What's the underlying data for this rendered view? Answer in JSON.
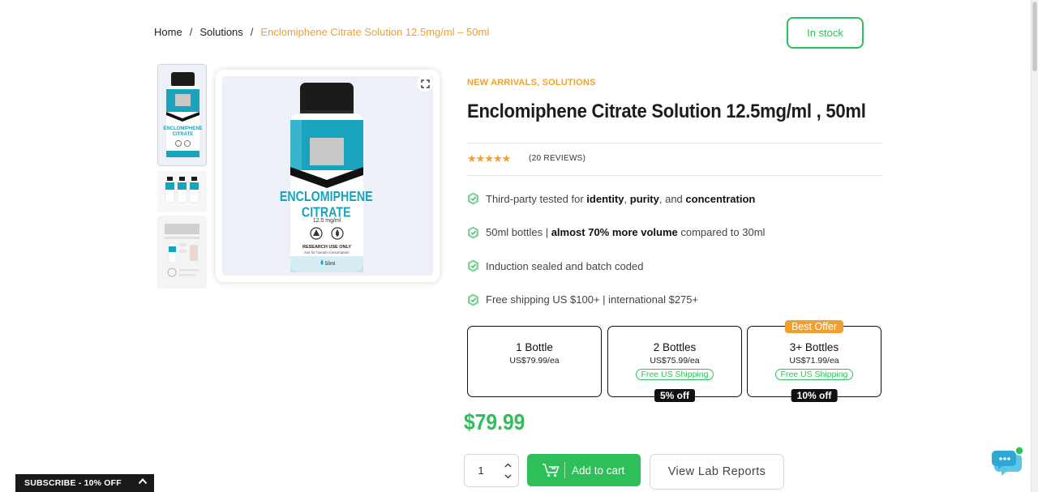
{
  "breadcrumb": {
    "home": "Home",
    "separator": "/",
    "section": "Solutions",
    "current": "Enclomiphene Citrate Solution 12.5mg/ml – 50ml"
  },
  "stock_status": "In stock",
  "product": {
    "categories": "NEW ARRIVALS, SOLUTIONS",
    "title": "Enclomiphene Citrate Solution 12.5mg/ml , 50ml",
    "rating_stars": 5,
    "reviews": "(20 REVIEWS)",
    "price": "$79.99",
    "image": {
      "label_line1": "ENCLOMIPHENE",
      "label_line2": "CITRATE",
      "concentration": "12.5 mg/ml",
      "research_text": "RESEARCH USE ONLY",
      "research_subtext": "Not for human consumption",
      "volume": "50ml"
    }
  },
  "features": [
    {
      "pre": "Third-party tested for ",
      "b1": "identity",
      "mid1": ", ",
      "b2": "purity",
      "mid2": ", and ",
      "b3": "concentration"
    },
    {
      "pre": "50ml bottles | ",
      "b1": "almost 70% more volume",
      "post": " compared to 30ml"
    },
    {
      "text": "Induction sealed and batch coded"
    },
    {
      "text": "Free shipping US $100+ | international $275+"
    }
  ],
  "offers": [
    {
      "title": "1 Bottle",
      "price": "US$79.99/ea"
    },
    {
      "title": "2 Bottles",
      "price": "US$75.99/ea",
      "shipping": "Free US Shipping",
      "discount": "5% off"
    },
    {
      "title": "3+ Bottles",
      "price": "US$71.99/ea",
      "shipping": "Free US Shipping",
      "discount": "10% off",
      "tag": "Best Offer"
    }
  ],
  "quantity": "1",
  "add_to_cart_label": "Add to cart",
  "lab_reports_label": "View Lab Reports",
  "subscribe_label": "SUBSCRIBE - 10% OFF",
  "colors": {
    "accent_orange": "#f0a030",
    "accent_green": "#2fbf5a",
    "bottle_teal": "#1aa3bf",
    "dark": "#111111"
  },
  "icons": [
    "expand-icon",
    "star-icon",
    "verified-badge-icon",
    "cart-icon",
    "chevron-up-icon",
    "chevron-down-icon",
    "chat-icon"
  ]
}
